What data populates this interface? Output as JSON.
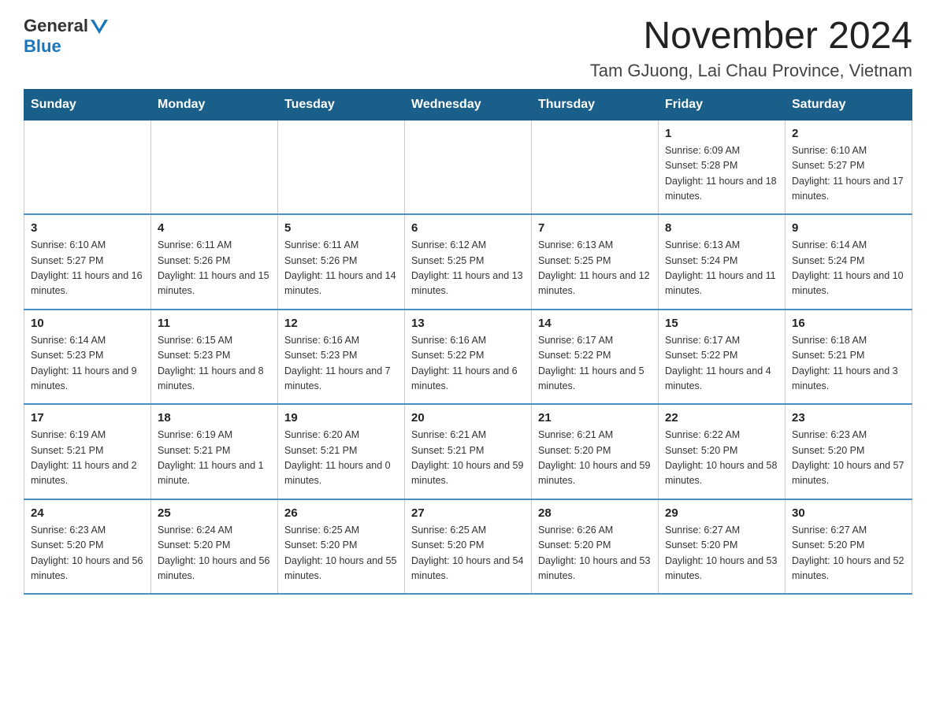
{
  "header": {
    "logo_general": "General",
    "logo_blue": "Blue",
    "title": "November 2024",
    "subtitle": "Tam GJuong, Lai Chau Province, Vietnam"
  },
  "weekdays": [
    "Sunday",
    "Monday",
    "Tuesday",
    "Wednesday",
    "Thursday",
    "Friday",
    "Saturday"
  ],
  "weeks": [
    [
      {
        "day": "",
        "info": ""
      },
      {
        "day": "",
        "info": ""
      },
      {
        "day": "",
        "info": ""
      },
      {
        "day": "",
        "info": ""
      },
      {
        "day": "",
        "info": ""
      },
      {
        "day": "1",
        "info": "Sunrise: 6:09 AM\nSunset: 5:28 PM\nDaylight: 11 hours and 18 minutes."
      },
      {
        "day": "2",
        "info": "Sunrise: 6:10 AM\nSunset: 5:27 PM\nDaylight: 11 hours and 17 minutes."
      }
    ],
    [
      {
        "day": "3",
        "info": "Sunrise: 6:10 AM\nSunset: 5:27 PM\nDaylight: 11 hours and 16 minutes."
      },
      {
        "day": "4",
        "info": "Sunrise: 6:11 AM\nSunset: 5:26 PM\nDaylight: 11 hours and 15 minutes."
      },
      {
        "day": "5",
        "info": "Sunrise: 6:11 AM\nSunset: 5:26 PM\nDaylight: 11 hours and 14 minutes."
      },
      {
        "day": "6",
        "info": "Sunrise: 6:12 AM\nSunset: 5:25 PM\nDaylight: 11 hours and 13 minutes."
      },
      {
        "day": "7",
        "info": "Sunrise: 6:13 AM\nSunset: 5:25 PM\nDaylight: 11 hours and 12 minutes."
      },
      {
        "day": "8",
        "info": "Sunrise: 6:13 AM\nSunset: 5:24 PM\nDaylight: 11 hours and 11 minutes."
      },
      {
        "day": "9",
        "info": "Sunrise: 6:14 AM\nSunset: 5:24 PM\nDaylight: 11 hours and 10 minutes."
      }
    ],
    [
      {
        "day": "10",
        "info": "Sunrise: 6:14 AM\nSunset: 5:23 PM\nDaylight: 11 hours and 9 minutes."
      },
      {
        "day": "11",
        "info": "Sunrise: 6:15 AM\nSunset: 5:23 PM\nDaylight: 11 hours and 8 minutes."
      },
      {
        "day": "12",
        "info": "Sunrise: 6:16 AM\nSunset: 5:23 PM\nDaylight: 11 hours and 7 minutes."
      },
      {
        "day": "13",
        "info": "Sunrise: 6:16 AM\nSunset: 5:22 PM\nDaylight: 11 hours and 6 minutes."
      },
      {
        "day": "14",
        "info": "Sunrise: 6:17 AM\nSunset: 5:22 PM\nDaylight: 11 hours and 5 minutes."
      },
      {
        "day": "15",
        "info": "Sunrise: 6:17 AM\nSunset: 5:22 PM\nDaylight: 11 hours and 4 minutes."
      },
      {
        "day": "16",
        "info": "Sunrise: 6:18 AM\nSunset: 5:21 PM\nDaylight: 11 hours and 3 minutes."
      }
    ],
    [
      {
        "day": "17",
        "info": "Sunrise: 6:19 AM\nSunset: 5:21 PM\nDaylight: 11 hours and 2 minutes."
      },
      {
        "day": "18",
        "info": "Sunrise: 6:19 AM\nSunset: 5:21 PM\nDaylight: 11 hours and 1 minute."
      },
      {
        "day": "19",
        "info": "Sunrise: 6:20 AM\nSunset: 5:21 PM\nDaylight: 11 hours and 0 minutes."
      },
      {
        "day": "20",
        "info": "Sunrise: 6:21 AM\nSunset: 5:21 PM\nDaylight: 10 hours and 59 minutes."
      },
      {
        "day": "21",
        "info": "Sunrise: 6:21 AM\nSunset: 5:20 PM\nDaylight: 10 hours and 59 minutes."
      },
      {
        "day": "22",
        "info": "Sunrise: 6:22 AM\nSunset: 5:20 PM\nDaylight: 10 hours and 58 minutes."
      },
      {
        "day": "23",
        "info": "Sunrise: 6:23 AM\nSunset: 5:20 PM\nDaylight: 10 hours and 57 minutes."
      }
    ],
    [
      {
        "day": "24",
        "info": "Sunrise: 6:23 AM\nSunset: 5:20 PM\nDaylight: 10 hours and 56 minutes."
      },
      {
        "day": "25",
        "info": "Sunrise: 6:24 AM\nSunset: 5:20 PM\nDaylight: 10 hours and 56 minutes."
      },
      {
        "day": "26",
        "info": "Sunrise: 6:25 AM\nSunset: 5:20 PM\nDaylight: 10 hours and 55 minutes."
      },
      {
        "day": "27",
        "info": "Sunrise: 6:25 AM\nSunset: 5:20 PM\nDaylight: 10 hours and 54 minutes."
      },
      {
        "day": "28",
        "info": "Sunrise: 6:26 AM\nSunset: 5:20 PM\nDaylight: 10 hours and 53 minutes."
      },
      {
        "day": "29",
        "info": "Sunrise: 6:27 AM\nSunset: 5:20 PM\nDaylight: 10 hours and 53 minutes."
      },
      {
        "day": "30",
        "info": "Sunrise: 6:27 AM\nSunset: 5:20 PM\nDaylight: 10 hours and 52 minutes."
      }
    ]
  ]
}
